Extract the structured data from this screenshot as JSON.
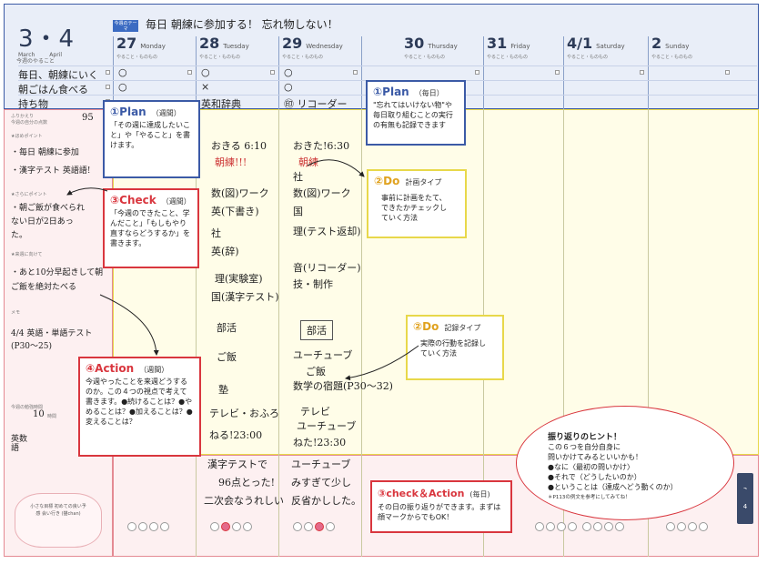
{
  "header": {
    "date": "3・4",
    "month_label": "March",
    "month_label2": "April",
    "week_todo_label": "今週のやること",
    "goal_tag": "今週のテーマ",
    "goal_text": "毎日 朝練に参加する！ 忘れ物しない！",
    "day_sub": "やること・ものもの"
  },
  "days": [
    {
      "num": "27",
      "name": "Monday"
    },
    {
      "num": "28",
      "name": "Tuesday"
    },
    {
      "num": "29",
      "name": "Wednesday"
    },
    {
      "num": "30",
      "name": "Thursday"
    },
    {
      "num": "31",
      "name": "Friday"
    },
    {
      "num": "4/1",
      "name": "Saturday"
    },
    {
      "num": "2",
      "name": "Sunday"
    }
  ],
  "week_todos": [
    "毎日、朝練にいく",
    "朝ごはん食べる",
    "持ち物"
  ],
  "plan_marks": {
    "mon": [
      "○",
      "○"
    ],
    "tue": [
      "○",
      "×",
      "英和辞典"
    ],
    "wed": [
      "○",
      "○",
      "㊞ リコーダー"
    ]
  },
  "review": {
    "furikaeri": "ふりかえり",
    "score_label": "今週の自分の点数",
    "score": "95",
    "homeru_label": "★ほめポイント",
    "homeru_text": "・毎日 朝練に参加",
    "homeru_text2": "・漢字テスト 英語語!",
    "improve_label": "★さらにポイント",
    "improve_text": "・朝ご飯が食べられない日が2日あった。",
    "next_label": "★来週に向けて",
    "next_text": "・あと10分早起きして朝ご飯を絶対たべる",
    "memo_label": "メモ",
    "memo_text": "4/4 英語・単語テスト (P30〜25)",
    "study_label": "今週の勉強時間",
    "study_value": "10",
    "study_unit": "時間",
    "legend": "英数語",
    "note_text": "小さな目標 初めての良い予感 会い行き (猫chan)"
  },
  "mon_schedule": [
    "おきる 6:10",
    "朝練!!!",
    "数(図)ワーク",
    "英(下書き)",
    "社",
    "英(辞)",
    "理(実験室)",
    "国(漢字テスト)",
    "部活",
    "ご飯",
    "塾",
    "テレビ・おふろ",
    "ねる!23:00"
  ],
  "wed_schedule": [
    "おきた!6:30",
    "朝練",
    "社",
    "数(図)ワーク",
    "国",
    "理(テスト返却)",
    "音(リコーダー)",
    "技・制作",
    "部活",
    "ユーチューブ",
    "ご飯",
    "数学の宿題(P30〜32)",
    "テレビ",
    "ユーチューブ",
    "ねた!23:30"
  ],
  "mon_review": [
    "漢字テストで",
    "96点とった!",
    "二次会なうれしい"
  ],
  "wed_review": [
    "ユーチューブ",
    "みすぎて少し",
    "反省かしした。"
  ],
  "callouts": {
    "plan_weekly": {
      "num": "①Plan",
      "sub": "（週間）",
      "body": "「その週に達成したいこと」や「やること」を書けます。"
    },
    "plan_daily": {
      "num": "①Plan",
      "sub": "（毎日）",
      "body": "\"忘れてはいけない物\"や毎日取り組むことの実行の有無も記録できます"
    },
    "do_plan": {
      "num": "②Do",
      "sub": "計画タイプ",
      "body": "事前に計画をたて、できたかチェックしていく方法"
    },
    "do_record": {
      "num": "②Do",
      "sub": "記録タイプ",
      "body": "実際の行動を記録していく方法"
    },
    "check_weekly": {
      "num": "③Check",
      "sub": "（週間）",
      "body": "「今週のできたこと、学んだこと」「もしもやり直すならどうするか」を書きます。"
    },
    "action_weekly": {
      "num": "④Action",
      "sub": "（週間）",
      "body": "今週やったことを来週どうするのか。この４つの視点で考えて書きます。●続けることは？●やめることは？●加えることは？●変えることは？"
    },
    "check_action_daily": {
      "num": "③check＆Action",
      "sub": "(毎日)",
      "body": "その日の振り返りができます。まずは顔マークからでもOK！"
    }
  },
  "hint": {
    "title": "振り返りのヒント！",
    "line1": "この６つを自分自身に",
    "line2": "問いかけてみるといいかも！",
    "line3": "●なに〈最初の問いかけ〉",
    "line4": "●それで（どうしたいのか）",
    "line5": "●ということは（達成へどう動くのか）",
    "note": "＊P113の例文を参考にしてみてね！"
  },
  "side_tabs": [
    "3",
    "4"
  ]
}
